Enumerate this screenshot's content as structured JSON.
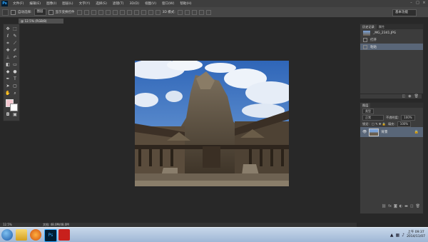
{
  "menubar": {
    "logo": "Ps",
    "items": [
      "文件(F)",
      "编辑(E)",
      "图像(I)",
      "图层(L)",
      "文字(Y)",
      "选择(S)",
      "滤镜(T)",
      "3D(D)",
      "视图(V)",
      "窗口(W)",
      "帮助(H)"
    ]
  },
  "options": {
    "auto_select_label": "自动选择:",
    "auto_select_value": "图层",
    "show_transform_label": "显示变换控件",
    "mode_3d_label": "3D 模式:",
    "workspace": "基本功能"
  },
  "document": {
    "tab_label": "@ 12.5% (RGB/8)"
  },
  "status": {
    "zoom": "12.5%",
    "doc_size": "文档: 48.0M/48.0M"
  },
  "history_panel": {
    "tabs": [
      "历史记录",
      "属性"
    ],
    "snapshot": "_MG_2341.JPG",
    "states": [
      "打开",
      "粘贴"
    ]
  },
  "layers_panel": {
    "tab": "图层",
    "kind": "类型",
    "blend_mode": "正常",
    "opacity_label": "不透明度:",
    "opacity_value": "100%",
    "lock_label": "锁定:",
    "fill_label": "填充:",
    "fill_value": "100%",
    "layer_name": "背景"
  },
  "taskbar": {
    "time": "上午 09:37",
    "date": "2014/11/07"
  },
  "colors": {
    "bg": "#282828",
    "panel": "#3c3c3c",
    "selection": "#596678"
  }
}
